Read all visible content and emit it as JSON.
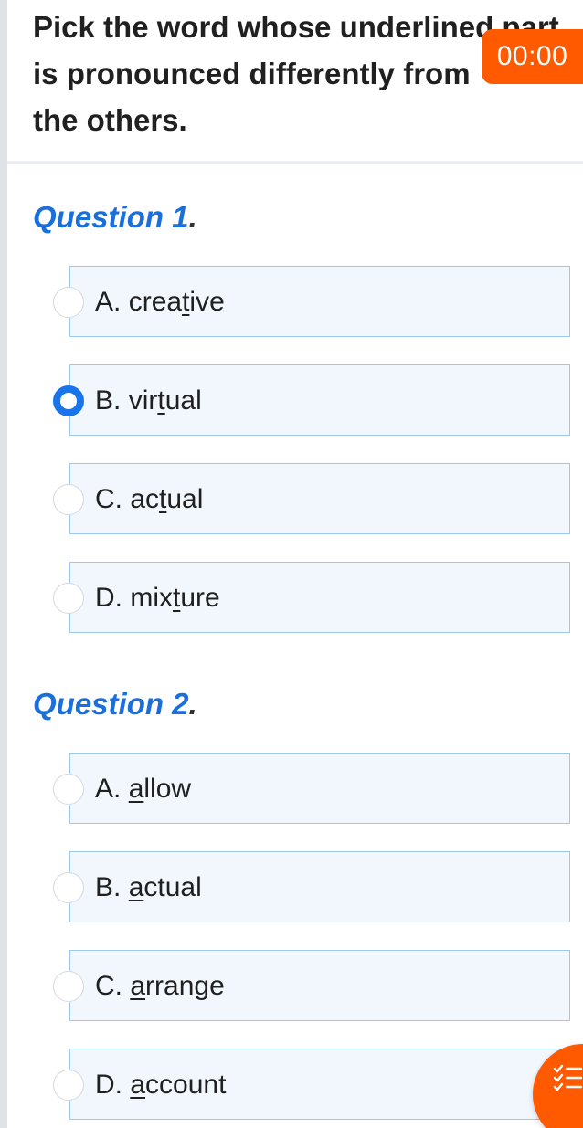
{
  "instruction": {
    "lines": [
      "Pick the word whose underlined part",
      "is pronounced differently from",
      "the others."
    ]
  },
  "timer": {
    "value": "00:00"
  },
  "questions": [
    {
      "title": "Question 1",
      "title_dot": ".",
      "options": [
        {
          "letter": "A.",
          "pre": "crea",
          "underlined": "t",
          "post": "ive",
          "selected": false
        },
        {
          "letter": "B.",
          "pre": "vir",
          "underlined": "t",
          "post": "ual",
          "selected": true
        },
        {
          "letter": "C.",
          "pre": "ac",
          "underlined": "t",
          "post": "ual",
          "selected": false
        },
        {
          "letter": "D.",
          "pre": "mix",
          "underlined": "t",
          "post": "ure",
          "selected": false
        }
      ]
    },
    {
      "title": "Question 2",
      "title_dot": ".",
      "options": [
        {
          "letter": "A.",
          "pre": "",
          "underlined": "a",
          "post": "llow",
          "selected": false
        },
        {
          "letter": "B.",
          "pre": "",
          "underlined": "a",
          "post": "ctual",
          "selected": false
        },
        {
          "letter": "C.",
          "pre": "",
          "underlined": "a",
          "post": "rrange",
          "selected": false
        },
        {
          "letter": "D.",
          "pre": "",
          "underlined": "a",
          "post": "ccount",
          "selected": false
        }
      ]
    }
  ],
  "colors": {
    "accent": "#1a6fdb",
    "timer_bg": "#ff5a00",
    "selected_radio": "#1774ea",
    "option_bg": "#f1f7fd",
    "option_border": "#9cc8ee"
  },
  "icons": {
    "fab": "question-list-icon"
  }
}
